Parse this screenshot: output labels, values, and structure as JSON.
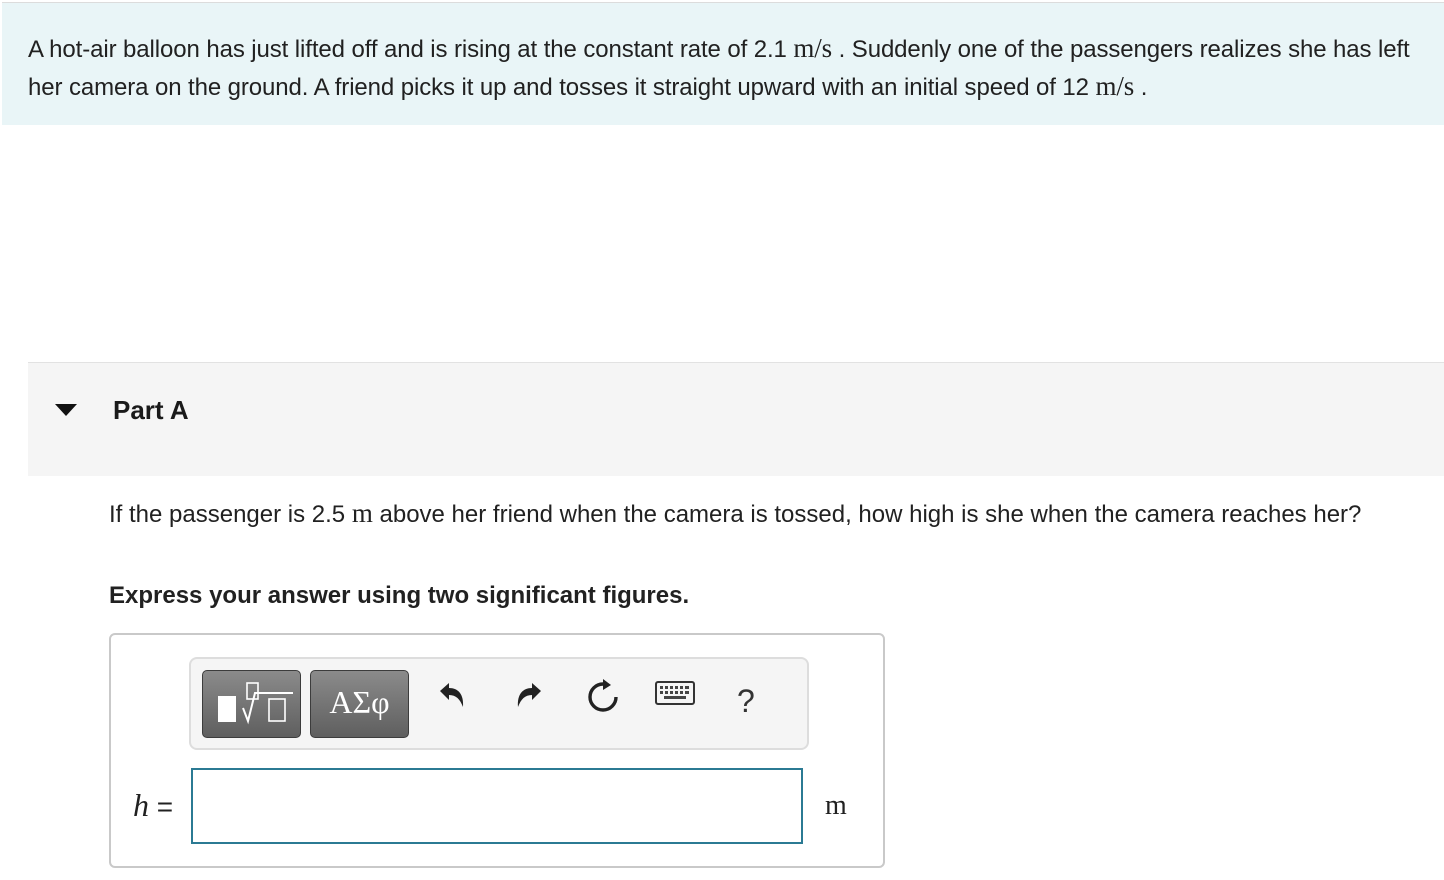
{
  "intro": {
    "t1": "A hot-air balloon has just lifted off and is rising at the constant rate of 2.1 ",
    "u1": "m/s",
    "t2": " . Suddenly one of the passengers realizes she has left her camera on the ground. A friend picks it up and tosses it straight upward with an initial speed of 12 ",
    "u2": "m/s",
    "t3": " ."
  },
  "part": {
    "title": "Part A"
  },
  "question": {
    "t1": "If the passenger is 2.5 ",
    "u1": "m",
    "t2": " above her friend when the camera is tossed, how high is she when the camera reaches her?"
  },
  "instruction": "Express your answer using two significant figures.",
  "toolbar": {
    "symbols_label": "ΑΣφ",
    "help_label": "?"
  },
  "answer": {
    "variable": "h",
    "equals": "=",
    "value": "",
    "unit": "m"
  }
}
